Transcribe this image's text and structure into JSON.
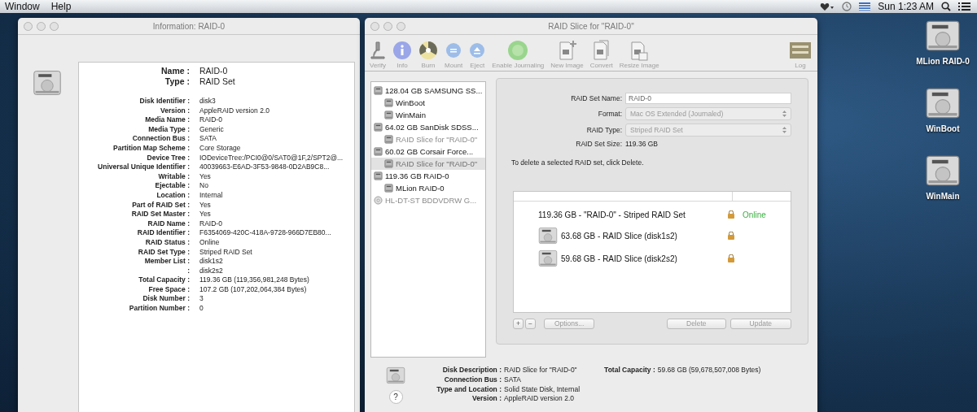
{
  "menu_bar": {
    "menus": [
      "Window",
      "Help"
    ],
    "clock": "Sun 1:23 AM"
  },
  "info_window": {
    "title": "Information: RAID-0",
    "rows": [
      {
        "kind": "heading",
        "label": "Name :",
        "value": "RAID-0"
      },
      {
        "kind": "heading",
        "label": "Type :",
        "value": "RAID Set"
      },
      {
        "kind": "detail",
        "label": "Disk Identifier :",
        "value": "disk3"
      },
      {
        "kind": "detail",
        "label": "Version :",
        "value": "AppleRAID version 2.0"
      },
      {
        "kind": "detail",
        "label": "Media Name :",
        "value": "RAID-0"
      },
      {
        "kind": "detail",
        "label": "Media Type :",
        "value": "Generic"
      },
      {
        "kind": "detail",
        "label": "Connection Bus :",
        "value": "SATA"
      },
      {
        "kind": "detail",
        "label": "Partition Map Scheme :",
        "value": "Core Storage"
      },
      {
        "kind": "detail",
        "label": "Device Tree :",
        "value": "IODeviceTree:/PCI0@0/SAT0@1F,2/SPT2@..."
      },
      {
        "kind": "detail",
        "label": "Universal Unique Identifier :",
        "value": "40039663-E6AD-3F53-9848-0D2AB9C8..."
      },
      {
        "kind": "detail",
        "label": "Writable :",
        "value": "Yes"
      },
      {
        "kind": "detail",
        "label": "Ejectable :",
        "value": "No"
      },
      {
        "kind": "detail",
        "label": "Location :",
        "value": "Internal"
      },
      {
        "kind": "detail",
        "label": "Part of RAID Set :",
        "value": "Yes"
      },
      {
        "kind": "detail",
        "label": "RAID Set Master :",
        "value": "Yes"
      },
      {
        "kind": "detail",
        "label": "RAID Name :",
        "value": "RAID-0"
      },
      {
        "kind": "detail",
        "label": "RAID Identifier :",
        "value": "F6354069-420C-418A-9728-966D7EB80..."
      },
      {
        "kind": "detail",
        "label": "RAID Status :",
        "value": "Online"
      },
      {
        "kind": "detail",
        "label": "RAID Set Type :",
        "value": "Striped RAID Set"
      },
      {
        "kind": "detail",
        "label": "Member List :",
        "value": "disk1s2"
      },
      {
        "kind": "detail",
        "label": ":",
        "value": "disk2s2"
      },
      {
        "kind": "detail",
        "label": "Total Capacity :",
        "value": "119.36 GB (119,356,981,248 Bytes)"
      },
      {
        "kind": "detail",
        "label": "Free Space :",
        "value": "107.2 GB (107,202,064,384 Bytes)"
      },
      {
        "kind": "detail",
        "label": "Disk Number :",
        "value": "3"
      },
      {
        "kind": "detail",
        "label": "Partition Number :",
        "value": "0"
      }
    ]
  },
  "utility_window": {
    "title": "RAID Slice for \"RAID-0\"",
    "toolbar": [
      {
        "kind": "microscope",
        "label": "Verify"
      },
      {
        "kind": "info",
        "label": "Info"
      },
      {
        "kind": "burn",
        "label": "Burn"
      },
      {
        "kind": "mount",
        "label": "Mount"
      },
      {
        "kind": "eject",
        "label": "Eject"
      },
      {
        "kind": "journal",
        "label": "Enable Journaling"
      },
      {
        "kind": "newimage",
        "label": "New Image"
      },
      {
        "kind": "convert",
        "label": "Convert"
      },
      {
        "kind": "resize",
        "label": "Resize Image"
      },
      {
        "kind": "log",
        "label": "Log"
      }
    ],
    "sidebar": [
      {
        "kind": "disk",
        "label": "128.04 GB SAMSUNG SS...",
        "selected": false,
        "disabled": false,
        "children": [
          {
            "kind": "volume",
            "label": "WinBoot",
            "selected": false,
            "disabled": false
          },
          {
            "kind": "volume",
            "label": "WinMain",
            "selected": false,
            "disabled": false
          }
        ]
      },
      {
        "kind": "disk",
        "label": "64.02 GB SanDisk SDSS...",
        "selected": false,
        "disabled": false,
        "children": [
          {
            "kind": "volume",
            "label": "RAID Slice for \"RAID-0\"",
            "selected": false,
            "disabled": true
          }
        ]
      },
      {
        "kind": "disk",
        "label": "60.02 GB Corsair Force...",
        "selected": false,
        "disabled": false,
        "children": [
          {
            "kind": "volume",
            "label": "RAID Slice for \"RAID-0\"",
            "selected": true,
            "disabled": true
          }
        ]
      },
      {
        "kind": "disk",
        "label": "119.36 GB RAID-0",
        "selected": false,
        "disabled": false,
        "children": [
          {
            "kind": "volume",
            "label": "MLion RAID-0",
            "selected": false,
            "disabled": false
          }
        ]
      },
      {
        "kind": "optical",
        "label": "HL-DT-ST BDDVDRW G...",
        "selected": false,
        "disabled": true
      }
    ],
    "form": [
      {
        "kind": "text",
        "label": "RAID Set Name:",
        "value": "RAID-0"
      },
      {
        "kind": "select",
        "label": "Format:",
        "value": "Mac OS Extended (Journaled)"
      },
      {
        "kind": "select",
        "label": "RAID Type:",
        "value": "Striped RAID Set"
      },
      {
        "kind": "static",
        "label": "RAID Set Size:",
        "value": "119.36 GB"
      }
    ],
    "note": "To delete a selected RAID set, click Delete.",
    "members": [
      {
        "kind": "set",
        "label": "119.36 GB - \"RAID-0\" - Striped RAID Set",
        "status": "Online"
      },
      {
        "kind": "slice",
        "label": "63.68 GB - RAID Slice (disk1s2)"
      },
      {
        "kind": "slice",
        "label": "59.68 GB - RAID Slice (disk2s2)"
      }
    ],
    "buttons_left": [
      "+",
      "−",
      "Options..."
    ],
    "buttons_right": [
      "Delete",
      "Update"
    ],
    "details": [
      {
        "label": "Disk Description :",
        "value": "RAID Slice for \"RAID-0\""
      },
      {
        "label": "Connection Bus :",
        "value": "SATA"
      },
      {
        "label": "Type and Location :",
        "value": "Solid State Disk, Internal"
      },
      {
        "label": "Version :",
        "value": "AppleRAID version 2.0"
      }
    ],
    "capacity": {
      "label": "Total Capacity :",
      "value": "59.68 GB (59,678,507,008 Bytes)"
    },
    "help": "?"
  },
  "desktop_icons": [
    "MLion RAID-0",
    "WinBoot",
    "WinMain"
  ]
}
